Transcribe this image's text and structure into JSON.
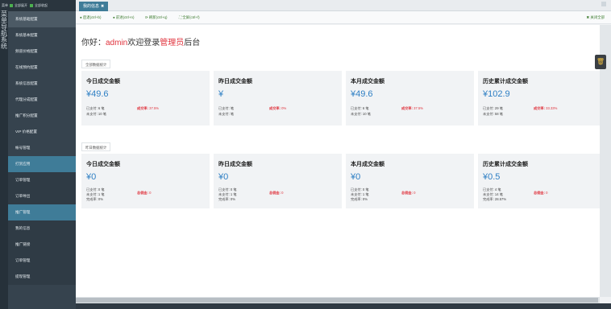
{
  "topbar": {
    "left_label": "菜单",
    "expand_all": "全部展开",
    "collapse_all": "全部收起"
  },
  "vstrip": {
    "chars": [
      "菜",
      "单",
      "导",
      "航",
      "系",
      "统"
    ]
  },
  "sidebar": {
    "items": [
      {
        "label": "系统基础配置",
        "state": "active"
      },
      {
        "label": "系统基本配置",
        "state": ""
      },
      {
        "label": "频道价格配置",
        "state": ""
      },
      {
        "label": "在线预约配置",
        "state": ""
      },
      {
        "label": "系统信息配置",
        "state": ""
      },
      {
        "label": "代理分成配置",
        "state": ""
      },
      {
        "label": "推广积分配置",
        "state": ""
      },
      {
        "label": "VIP 价格配置",
        "state": ""
      },
      {
        "label": "帐号管理",
        "state": ""
      },
      {
        "label": "打赏应用",
        "state": "hl"
      },
      {
        "label": "订单管理",
        "state": "dark"
      },
      {
        "label": "订单导出",
        "state": "dark"
      },
      {
        "label": "推广管理",
        "state": "hl"
      },
      {
        "label": "我的信息",
        "state": "dark"
      },
      {
        "label": "推广链接",
        "state": "dark"
      },
      {
        "label": "订单管理",
        "state": "dark"
      },
      {
        "label": "提现管理",
        "state": "dark"
      }
    ]
  },
  "tabs": [
    {
      "label": "我的信息",
      "close": "✖"
    }
  ],
  "toolbar": {
    "back": "● 后退(ctrl+b)",
    "forward": "● 前进(ctrl+n)",
    "refresh": "⟳ 刷新(ctrl+q)",
    "fullscreen": "⛶ 全屏(ctrl+f)",
    "close_all": "✖ 关闭全部"
  },
  "welcome": {
    "prefix": "你好：",
    "user": "admin",
    "middle": "欢迎登录",
    "role": "管理员",
    "suffix": "后台"
  },
  "section_all": "全部数据统计",
  "section_yesterday": "昨日数据统计",
  "cards_all": [
    {
      "title": "今日成交金额",
      "amount": "¥49.6",
      "line1": "已支付: 6 笔",
      "line2": "未支付: 10 笔",
      "rate_label": "成交率:",
      "rate_value": "37.5%"
    },
    {
      "title": "昨日成交金额",
      "amount": "¥",
      "line1": "已支付: 笔",
      "line2": "未支付: 笔",
      "rate_label": "成交率:",
      "rate_value": "0%"
    },
    {
      "title": "本月成交金额",
      "amount": "¥49.6",
      "line1": "已支付: 6 笔",
      "line2": "未支付: 10 笔",
      "rate_label": "成交率:",
      "rate_value": "37.5%"
    },
    {
      "title": "历史累计成交金额",
      "amount": "¥102.9",
      "line1": "已支付: 29 笔",
      "line2": "未支付: 58 笔",
      "rate_label": "成交率:",
      "rate_value": "33.33%"
    }
  ],
  "cards_yesterday": [
    {
      "title": "今日成交金额",
      "amount": "¥0",
      "line1": "已支付: 0 笔",
      "line2": "未支付: 1 笔",
      "line3": "完成率: 0%",
      "rate_label": "总佣金:",
      "rate_value": "0"
    },
    {
      "title": "昨日成交金额",
      "amount": "¥0",
      "line1": "已支付: 0 笔",
      "line2": "未支付: 1 笔",
      "line3": "完成率: 0%",
      "rate_label": "总佣金:",
      "rate_value": "0"
    },
    {
      "title": "本月成交金额",
      "amount": "¥0",
      "line1": "已支付: 0 笔",
      "line2": "未支付: 1 笔",
      "line3": "完成率: 0%",
      "rate_label": "总佣金:",
      "rate_value": "0"
    },
    {
      "title": "历史累计成交金额",
      "amount": "¥0.5",
      "line1": "已支付: 4 笔",
      "line2": "未支付: 14 笔",
      "line3": "完成率: 28.57%",
      "rate_label": "总佣金:",
      "rate_value": "0"
    }
  ],
  "float_button_icon": "trash-icon"
}
